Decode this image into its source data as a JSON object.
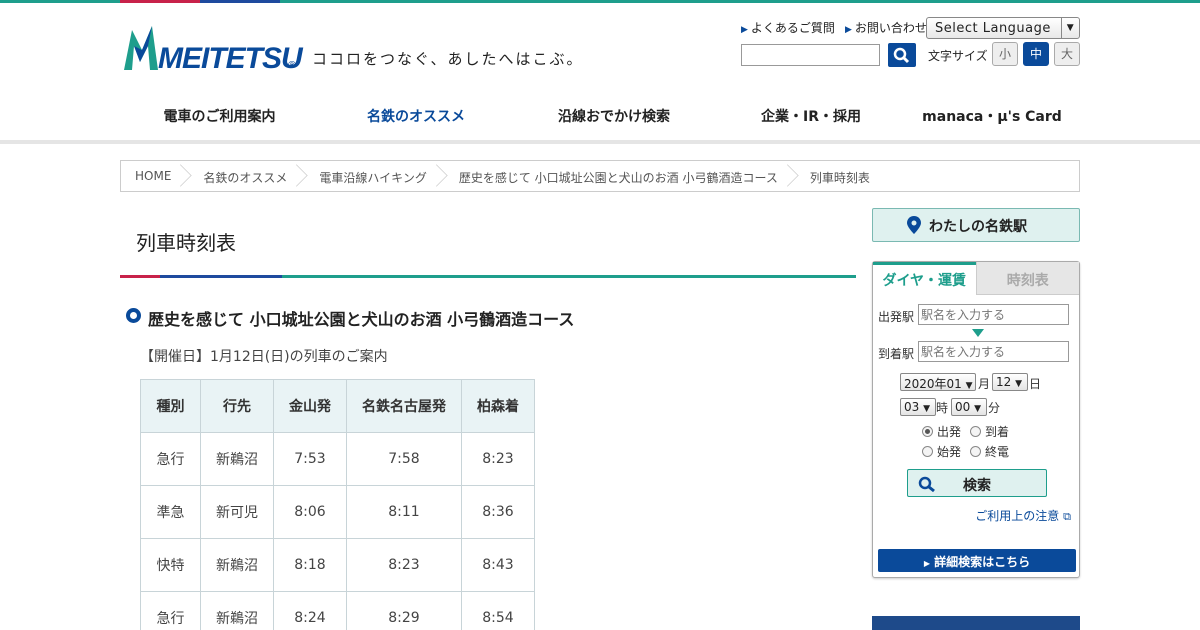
{
  "brand": {
    "logo_text": "MEITETSU",
    "registered": "®",
    "tagline": "ココロをつなぐ、あしたへはこぶ。"
  },
  "utility": {
    "links": [
      "よくあるご質問",
      "お問い合わせ"
    ],
    "language_select": "Select Language",
    "font_size_label": "文字サイズ",
    "font_sizes": [
      "小",
      "中",
      "大"
    ],
    "font_size_selected": "中"
  },
  "gnav": {
    "items": [
      "電車のご利用案内",
      "名鉄のオススメ",
      "沿線おでかけ検索",
      "企業・IR・採用",
      "manaca・μ's Card"
    ],
    "active": "名鉄のオススメ"
  },
  "breadcrumb": [
    "HOME",
    "名鉄のオススメ",
    "電車沿線ハイキング",
    "歴史を感じて 小口城址公園と犬山のお酒 小弓鶴酒造コース",
    "列車時刻表"
  ],
  "main": {
    "page_title": "列車時刻表",
    "course_title": "歴史を感じて 小口城址公園と犬山のお酒 小弓鶴酒造コース",
    "date_line": "【開催日】1月12日(日)の列車のご案内",
    "table": {
      "headers": [
        "種別",
        "行先",
        "金山発",
        "名鉄名古屋発",
        "柏森着"
      ],
      "rows": [
        [
          "急行",
          "新鵜沼",
          "7:53",
          "7:58",
          "8:23"
        ],
        [
          "準急",
          "新可児",
          "8:06",
          "8:11",
          "8:36"
        ],
        [
          "快特",
          "新鵜沼",
          "8:18",
          "8:23",
          "8:43"
        ],
        [
          "急行",
          "新鵜沼",
          "8:24",
          "8:29",
          "8:54"
        ]
      ]
    }
  },
  "sidebar": {
    "my_meitetsu": "わたしの名鉄駅",
    "widget": {
      "tabs": [
        "ダイヤ・運賃",
        "時刻表"
      ],
      "active_tab": "ダイヤ・運賃",
      "from_label": "出発駅",
      "from_placeholder": "駅名を入力する",
      "to_label": "到着駅",
      "to_placeholder": "駅名を入力する",
      "year_month": "2020年01",
      "month_unit": "月",
      "day": "12",
      "day_unit": "日",
      "hour": "03",
      "hour_unit": "時",
      "minute": "00",
      "minute_unit": "分",
      "options": [
        "出発",
        "到着",
        "始発",
        "終電"
      ],
      "selected_option": "出発",
      "search_label": "検索",
      "note": "ご利用上の注意",
      "detail_search": "詳細検索はこちら"
    }
  }
}
